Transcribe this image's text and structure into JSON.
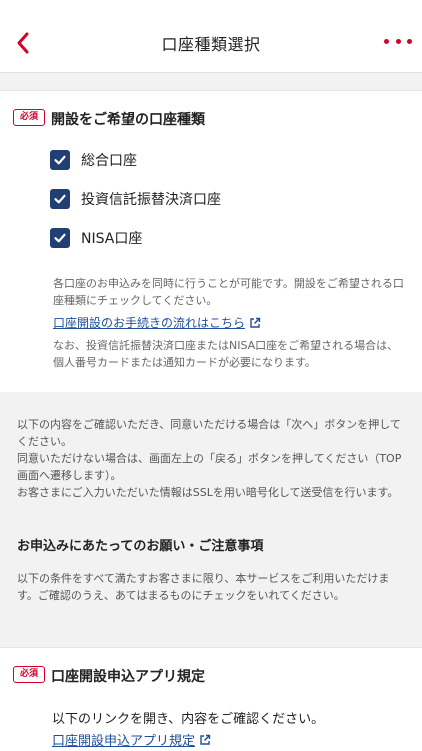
{
  "header": {
    "title": "口座種類選択"
  },
  "section_account_types": {
    "required_badge": "必須",
    "title": "開設をご希望の口座種類",
    "options": [
      {
        "label": "総合口座",
        "checked": true
      },
      {
        "label": "投資信託振替決済口座",
        "checked": true
      },
      {
        "label": "NISA口座",
        "checked": true
      }
    ],
    "note1": "各口座のお申込みを同時に行うことが可能です。開設をご希望される口座種類にチェックしてください。",
    "link": "口座開設のお手続きの流れはこちら",
    "note2": "なお、投資信託振替決済口座またはNISA口座をご希望される場合は、個人番号カードまたは通知カードが必要になります。"
  },
  "section_info": {
    "paragraphs": [
      "以下の内容をご確認いただき、同意いただける場合は「次へ」ボタンを押してください。",
      "同意いただけない場合は、画面左上の「戻る」ボタンを押してください（TOP画面へ遷移します）。",
      "お客さまにご入力いただいた情報はSSLを用い暗号化して送受信を行います。"
    ],
    "subtitle": "お申込みにあたってのお願い・ご注意事項",
    "condition_text": "以下の条件をすべて満たすお客さまに限り、本サービスをご利用いただけます。ご確認のうえ、あてはまるものにチェックをいれてください。"
  },
  "section_rules": {
    "required_badge": "必須",
    "title": "口座開設申込アプリ規定",
    "text": "以下のリンクを開き、内容をご確認ください。",
    "link": "口座開設申込アプリ規定"
  },
  "colors": {
    "accent_red": "#d4002a",
    "checkbox_navy": "#213f73",
    "link_blue": "#1f4f9a"
  }
}
